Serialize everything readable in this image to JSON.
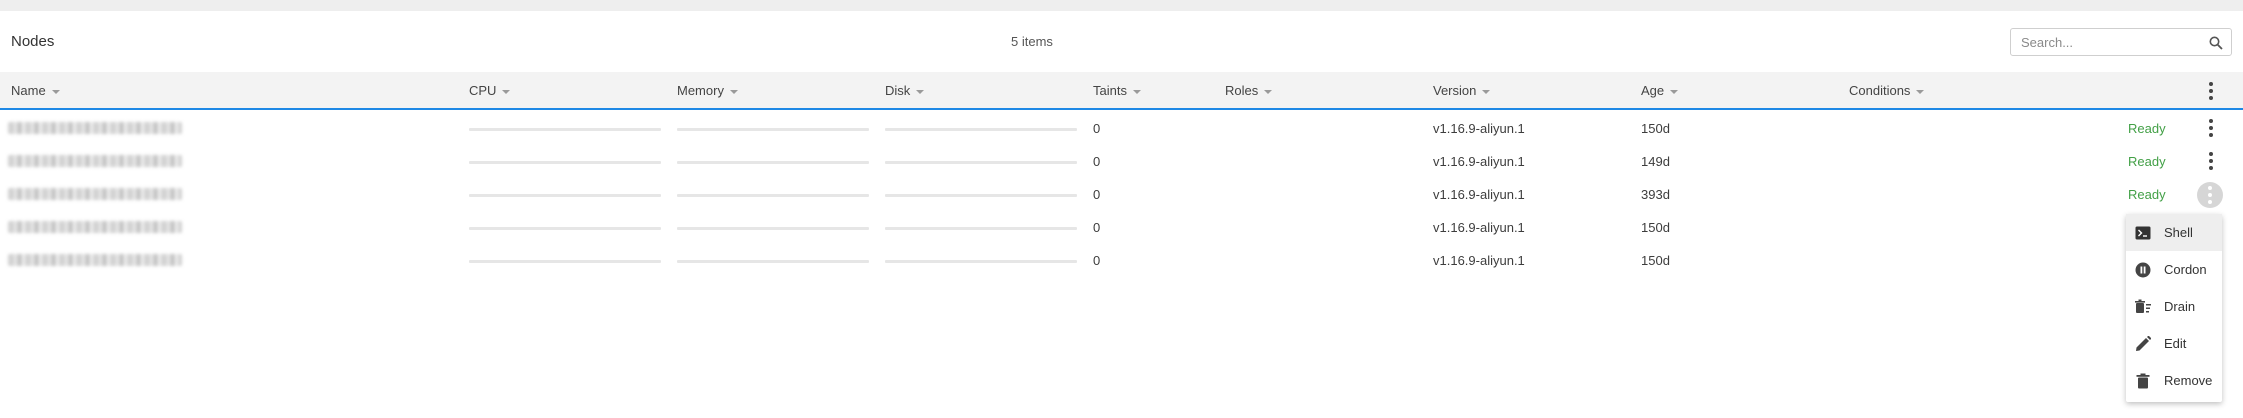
{
  "header": {
    "title": "Nodes",
    "item_count": "5 items"
  },
  "search": {
    "placeholder": "Search..."
  },
  "table": {
    "columns": [
      "Name",
      "CPU",
      "Memory",
      "Disk",
      "Taints",
      "Roles",
      "Version",
      "Age",
      "Conditions"
    ],
    "rows": [
      {
        "taints": "0",
        "version": "v1.16.9-aliyun.1",
        "age": "150d",
        "status": "Ready"
      },
      {
        "taints": "0",
        "version": "v1.16.9-aliyun.1",
        "age": "149d",
        "status": "Ready"
      },
      {
        "taints": "0",
        "version": "v1.16.9-aliyun.1",
        "age": "393d",
        "status": "Ready"
      },
      {
        "taints": "0",
        "version": "v1.16.9-aliyun.1",
        "age": "150d",
        "status": ""
      },
      {
        "taints": "0",
        "version": "v1.16.9-aliyun.1",
        "age": "150d",
        "status": ""
      }
    ]
  },
  "context_menu": {
    "items": [
      {
        "label": "Shell",
        "icon": "terminal-icon"
      },
      {
        "label": "Cordon",
        "icon": "pause-circle-icon"
      },
      {
        "label": "Drain",
        "icon": "drain-icon"
      },
      {
        "label": "Edit",
        "icon": "pencil-icon"
      },
      {
        "label": "Remove",
        "icon": "trash-icon"
      }
    ]
  },
  "colors": {
    "accent": "#1e88e5",
    "ready": "#43a047",
    "header_bg": "#f3f3f3"
  }
}
